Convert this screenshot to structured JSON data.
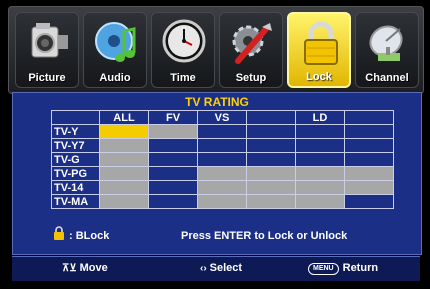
{
  "tabs": [
    {
      "label": "Picture",
      "icon": "camera-icon"
    },
    {
      "label": "Audio",
      "icon": "music-note-icon"
    },
    {
      "label": "Time",
      "icon": "clock-icon"
    },
    {
      "label": "Setup",
      "icon": "tools-icon"
    },
    {
      "label": "Lock",
      "icon": "padlock-icon",
      "active": true
    },
    {
      "label": "Channel",
      "icon": "satellite-dish-icon"
    }
  ],
  "panel": {
    "title": "TV RATING",
    "columns": [
      "ALL",
      "FV",
      "VS",
      "",
      "LD",
      ""
    ],
    "rows": [
      {
        "label": "TV-Y"
      },
      {
        "label": "TV-Y7"
      },
      {
        "label": "TV-G"
      },
      {
        "label": "TV-PG"
      },
      {
        "label": "TV-14"
      },
      {
        "label": "TV-MA"
      }
    ],
    "legend": ": BLock",
    "instruction": "Press ENTER to Lock or Unlock"
  },
  "footer": {
    "move": "Move",
    "select": "Select",
    "menu_key": "MENU",
    "return": "Return"
  },
  "colors": {
    "panel_bg": "#1b2f86",
    "title": "#ffd100",
    "selected_cell": "#f4cc00",
    "locked_cell": "#a7a7a7"
  }
}
